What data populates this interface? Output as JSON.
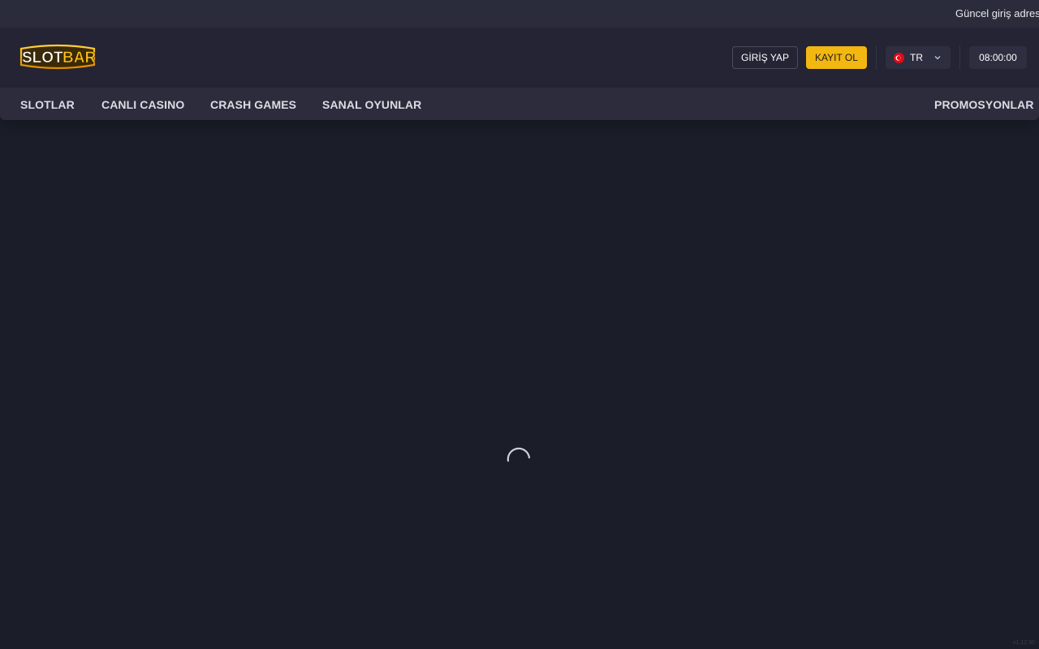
{
  "ticker": {
    "text": "Güncel giriş adres"
  },
  "header": {
    "logo_text_left": "SLOT",
    "logo_text_right": "BAR",
    "login_label": "GİRİŞ YAP",
    "register_label": "KAYIT OL",
    "language": "TR",
    "clock": "08:00:00"
  },
  "nav": {
    "items": [
      {
        "label": "SLOTLAR"
      },
      {
        "label": "CANLI CASINO"
      },
      {
        "label": "CRASH GAMES"
      },
      {
        "label": "SANAL OYUNLAR"
      }
    ],
    "promotions_label": "PROMOSYONLAR"
  },
  "footer": {
    "version": "v1.12.50"
  },
  "colors": {
    "background": "#1b1e29",
    "header": "#242434",
    "nav": "#2c2c3c",
    "accent": "#f3b712"
  },
  "icons": {
    "flag": "turkey-flag-icon",
    "chevron": "chevron-down-icon",
    "loading": "loading-spinner-icon"
  }
}
